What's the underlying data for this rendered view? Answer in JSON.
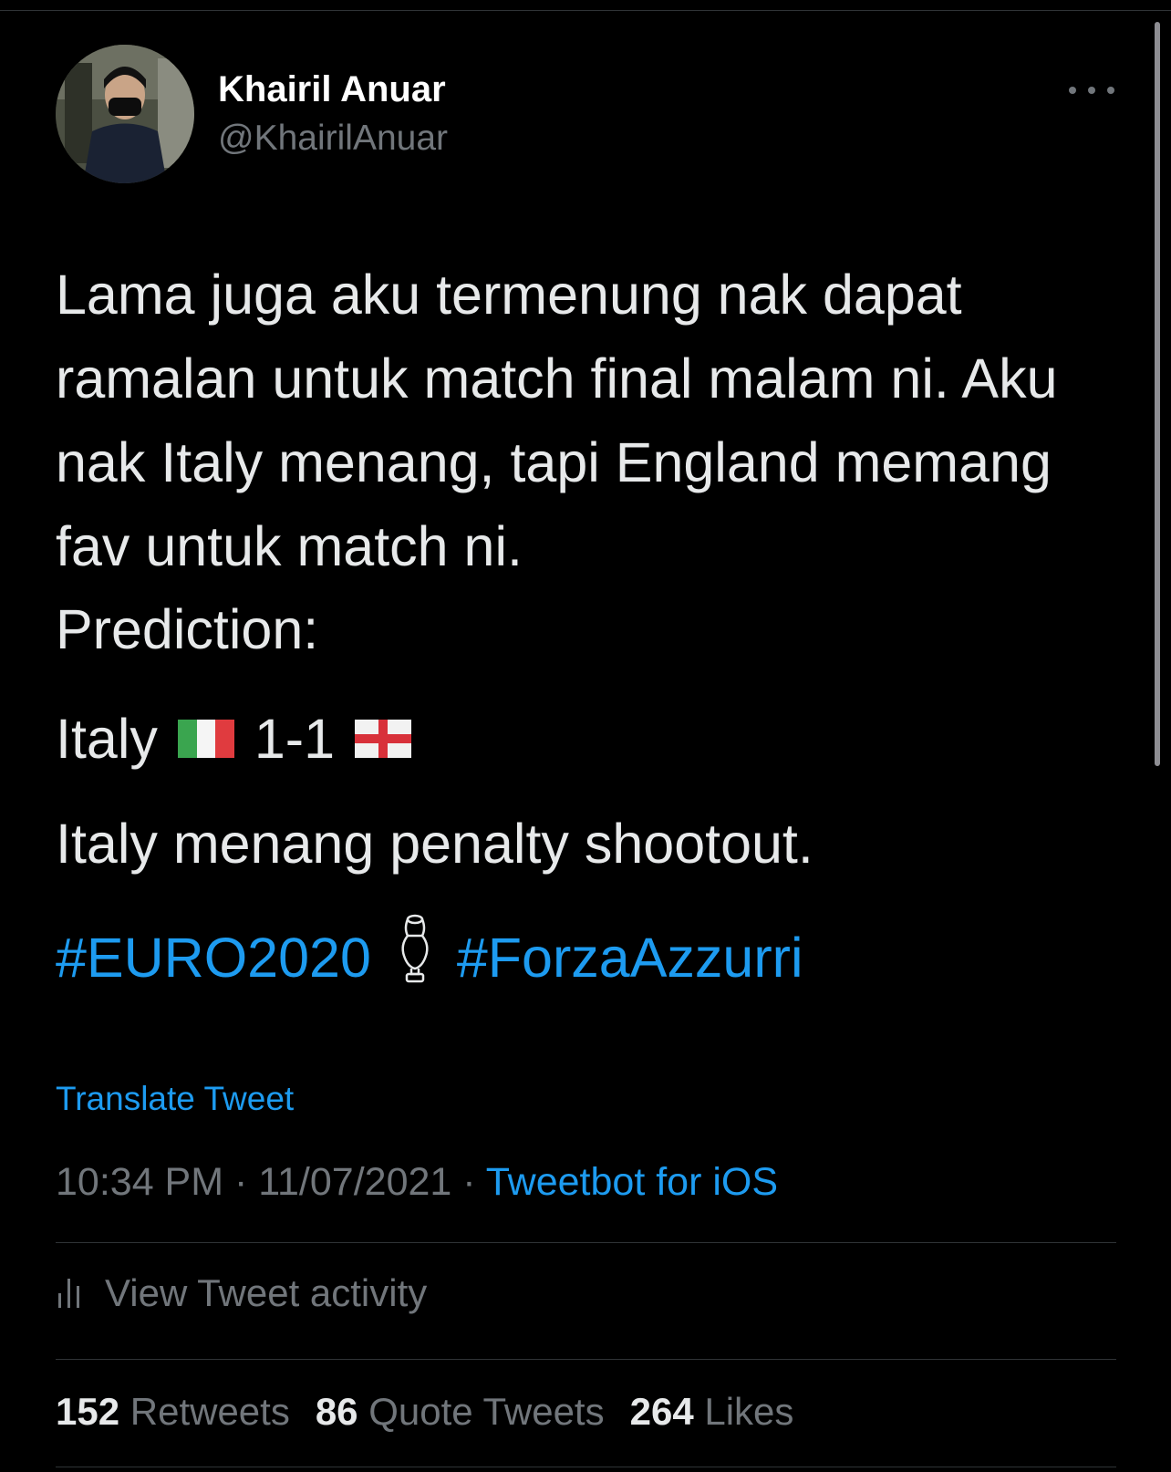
{
  "author": {
    "display_name": "Khairil Anuar",
    "handle": "@KhairilAnuar"
  },
  "tweet": {
    "paragraph_1": "Lama juga aku termenung nak dapat ramalan untuk match final malam ni. Aku nak Italy menang, tapi England memang fav untuk match ni.",
    "prediction_label": "Prediction:",
    "score_team": "Italy",
    "score": "1-1",
    "result_line": "Italy menang penalty shootout.",
    "hashtags": [
      "#EURO2020",
      "#ForzaAzzurri"
    ]
  },
  "translate_label": "Translate Tweet",
  "meta": {
    "time": "10:34 PM",
    "separator": "·",
    "date": "11/07/2021",
    "client": "Tweetbot for iOS"
  },
  "activity_label": "View Tweet activity",
  "stats": {
    "retweets_count": "152",
    "retweets_label": "Retweets",
    "quotes_count": "86",
    "quotes_label": "Quote Tweets",
    "likes_count": "264",
    "likes_label": "Likes"
  },
  "icons": {
    "more": "more-horizontal-icon",
    "activity": "bar-chart-icon",
    "flag_1": "italy-flag-icon",
    "flag_2": "england-flag-icon",
    "trophy": "trophy-icon"
  },
  "colors": {
    "background": "#000000",
    "text": "#e7e9ea",
    "secondary": "#71767b",
    "accent": "#1d9bf0",
    "divider": "#2f3336"
  }
}
